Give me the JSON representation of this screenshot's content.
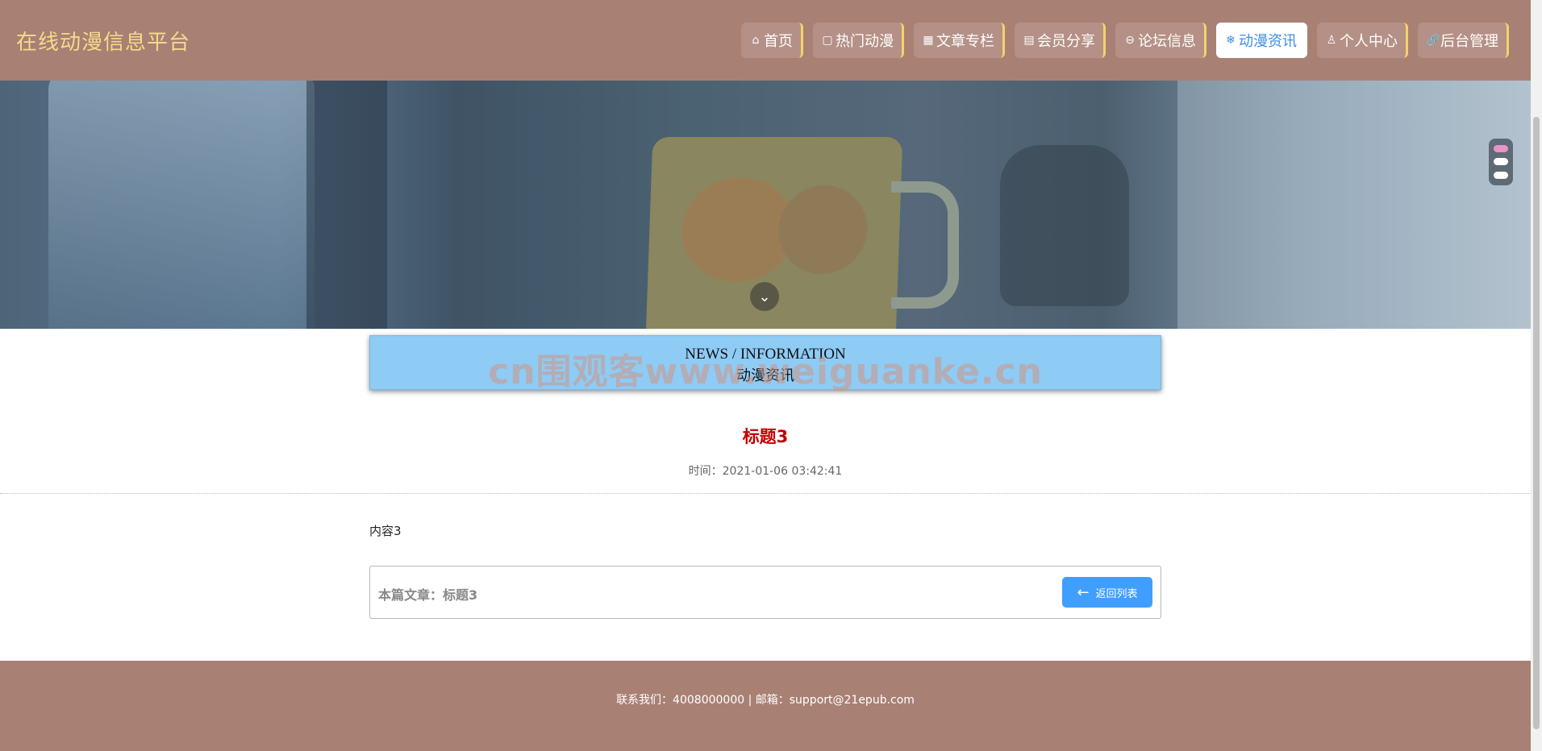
{
  "header": {
    "brand": "在线动漫信息平台",
    "nav": [
      {
        "icon": "⌂",
        "label": "首页"
      },
      {
        "icon": "▢",
        "label": "热门动漫"
      },
      {
        "icon": "▦",
        "label": "文章专栏"
      },
      {
        "icon": "▤",
        "label": "会员分享"
      },
      {
        "icon": "⊖",
        "label": "论坛信息"
      },
      {
        "icon": "❄",
        "label": "动漫资讯"
      },
      {
        "icon": "♙",
        "label": "个人中心"
      },
      {
        "icon": "🔗",
        "label": "后台管理"
      }
    ],
    "active_nav": "动漫资讯"
  },
  "banner": {
    "down_icon": "chevron-down-icon",
    "down_glyph": "⌄"
  },
  "section": {
    "title_en": "NEWS / INFORMATION",
    "title_cn": "动漫资讯",
    "watermark": "cn围观客www.weiguanke.cn"
  },
  "article": {
    "title": "标题3",
    "time": "时间：2021-01-06 03:42:41",
    "content": "内容3",
    "current_label": "本篇文章：标题3",
    "back_label": "返回列表",
    "back_icon": "←"
  },
  "footer": {
    "text": "联系我们：4008000000 | 邮箱：support@21epub.com"
  },
  "colors": {
    "header_bg": "#a98074",
    "brand": "#f7d98a",
    "accent": "#409eff",
    "title_red": "#c00000",
    "title_box_bg": "#8ecbf5"
  }
}
